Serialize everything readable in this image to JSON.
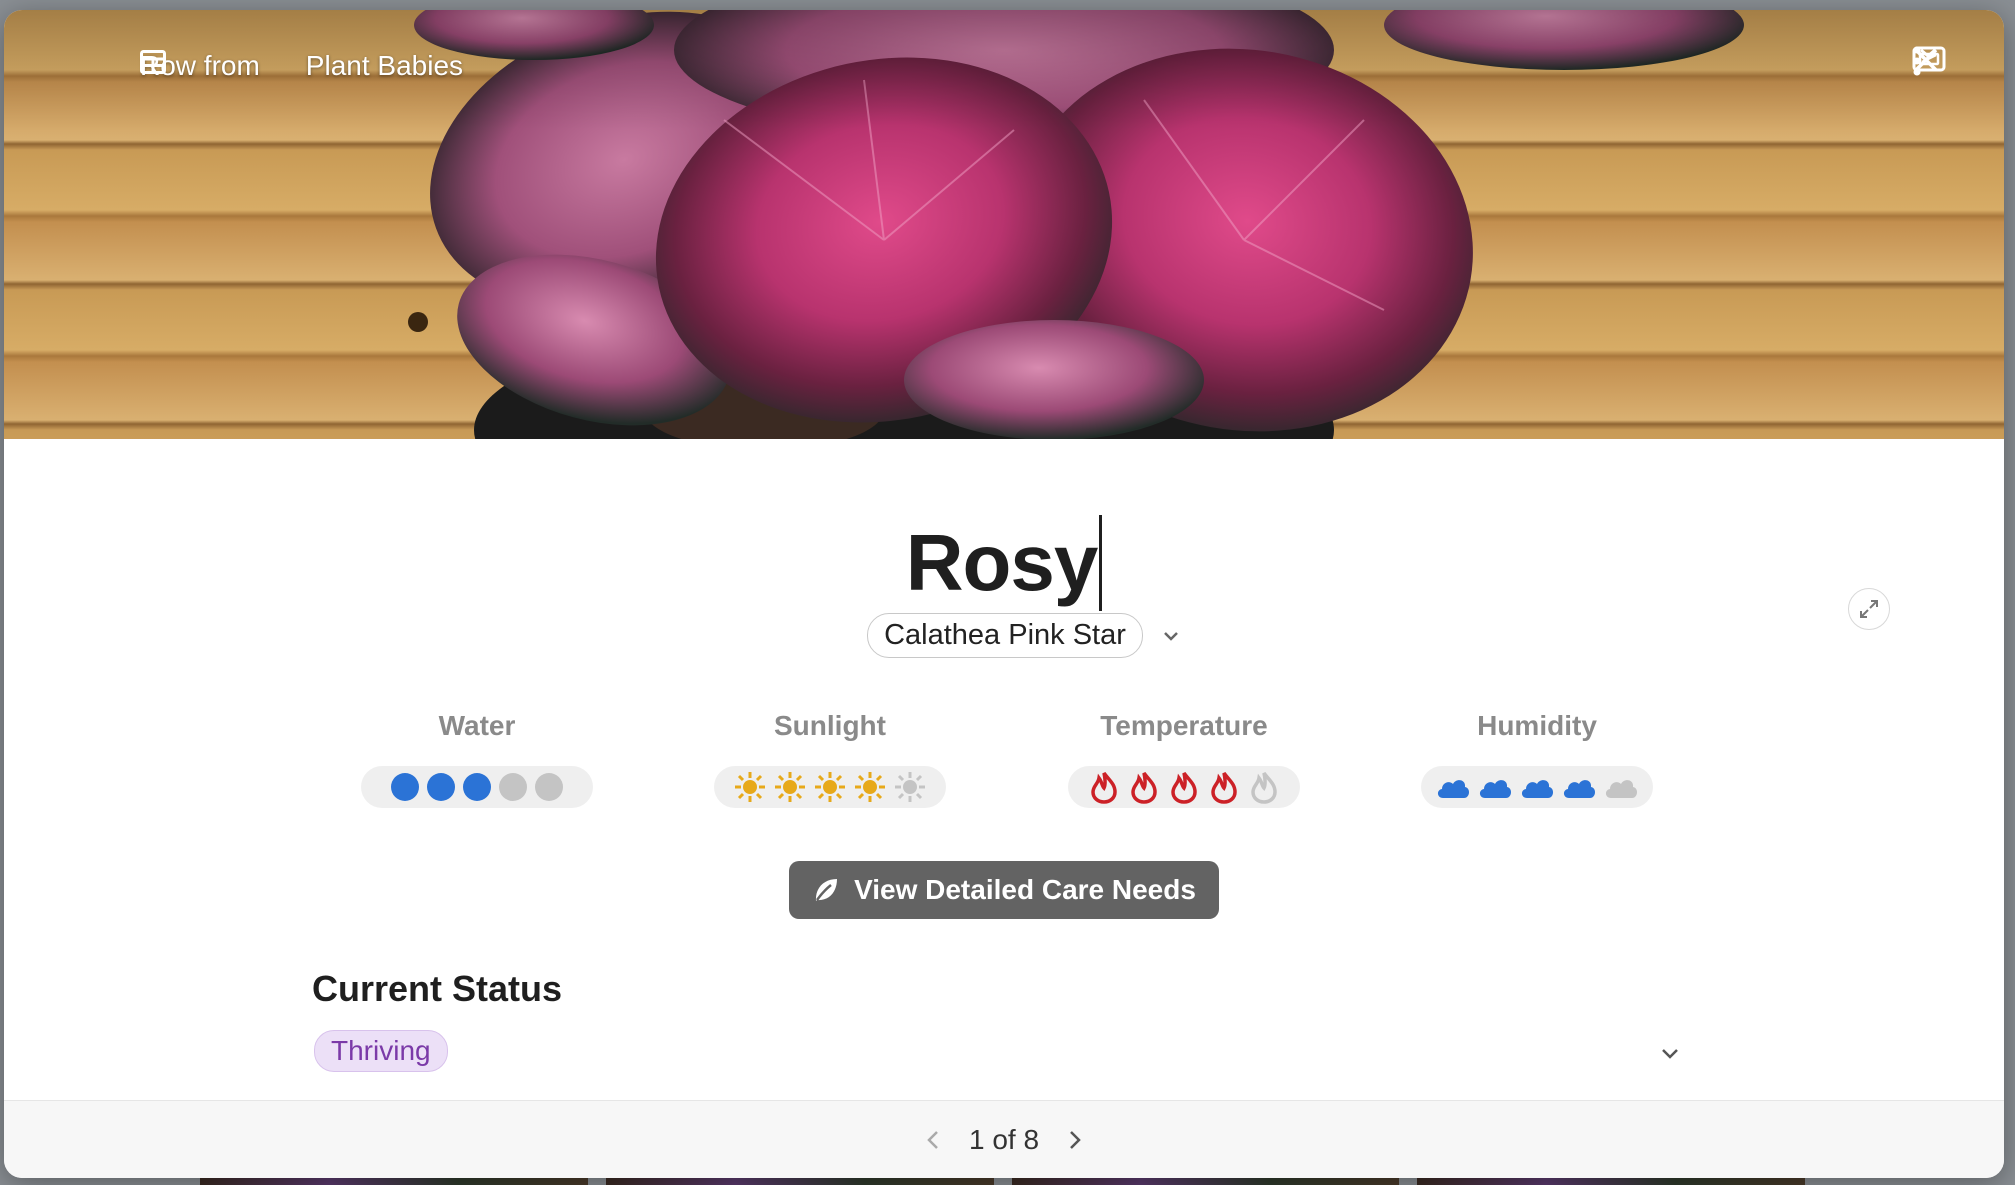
{
  "breadcrumb": {
    "prefix": "Row from",
    "table_name": "Plant Babies"
  },
  "record": {
    "title": "Rosy",
    "species": "Calathea Pink Star"
  },
  "metrics": [
    {
      "label": "Water",
      "icon": "droplet-dot",
      "level": 3,
      "max": 5,
      "color": "#2b73d6"
    },
    {
      "label": "Sunlight",
      "icon": "sun",
      "level": 4,
      "max": 5,
      "color": "#e7a91a"
    },
    {
      "label": "Temperature",
      "icon": "flame",
      "level": 4,
      "max": 5,
      "color": "#cc2127"
    },
    {
      "label": "Humidity",
      "icon": "cloud",
      "level": 4,
      "max": 5,
      "color": "#2b73d6"
    }
  ],
  "care_button": {
    "label": "View Detailed Care Needs",
    "icon": "leaf-icon"
  },
  "status": {
    "heading": "Current Status",
    "value": "Thriving"
  },
  "pagination": {
    "text": "1 of 8"
  }
}
